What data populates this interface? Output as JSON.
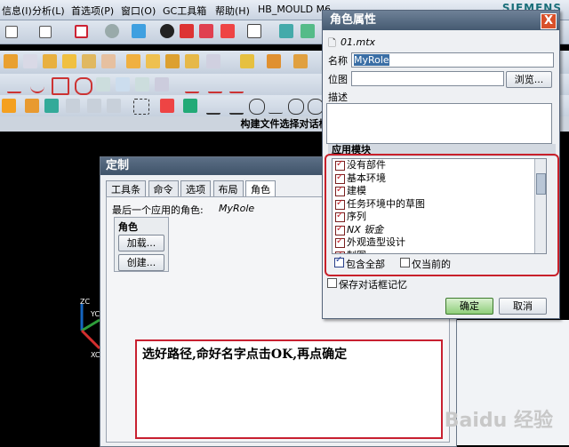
{
  "menubar": {
    "items": [
      "信息(I)",
      "分析(L)",
      "首选项(P)",
      "窗口(O)",
      "GC工具箱",
      "帮助(H)",
      "HB_MOULD M6"
    ],
    "brand": "SIEMENS"
  },
  "caption": "构建文件选择对话框",
  "custom_dialog": {
    "title": "定制",
    "tabs": [
      "工具条",
      "命令",
      "选项",
      "布局",
      "角色"
    ],
    "last_role_label": "最后一个应用的角色:",
    "last_role_value": "MyRole",
    "group_label": "角色",
    "load_button": "加载...",
    "create_button": "创建..."
  },
  "role_dialog": {
    "title": "角色属性",
    "close": "X",
    "file_name": "01.mtx",
    "name_label": "名称",
    "name_value": "MyRole",
    "bitmap_label": "位图",
    "bitmap_value": "",
    "browse_button": "浏览...",
    "desc_label": "描述",
    "desc_value": "",
    "modules_label": "应用模块",
    "modules": [
      "没有部件",
      "基本环境",
      "建模",
      "任务环境中的草图",
      "序列",
      "NX 钣金",
      "外观造型设计",
      "制图"
    ],
    "include_all_label": "包含全部",
    "current_only_label": "仅当前的",
    "save_dialog_memory_label": "保存对话框记忆",
    "ok_button": "确定",
    "cancel_button": "取消"
  },
  "triad": {
    "zc": "ZC",
    "yc": "YC",
    "xc": "XC"
  },
  "annotation_note": "选好路径,命好名字点击OK,再点确定",
  "watermark": "Baidu 经验"
}
